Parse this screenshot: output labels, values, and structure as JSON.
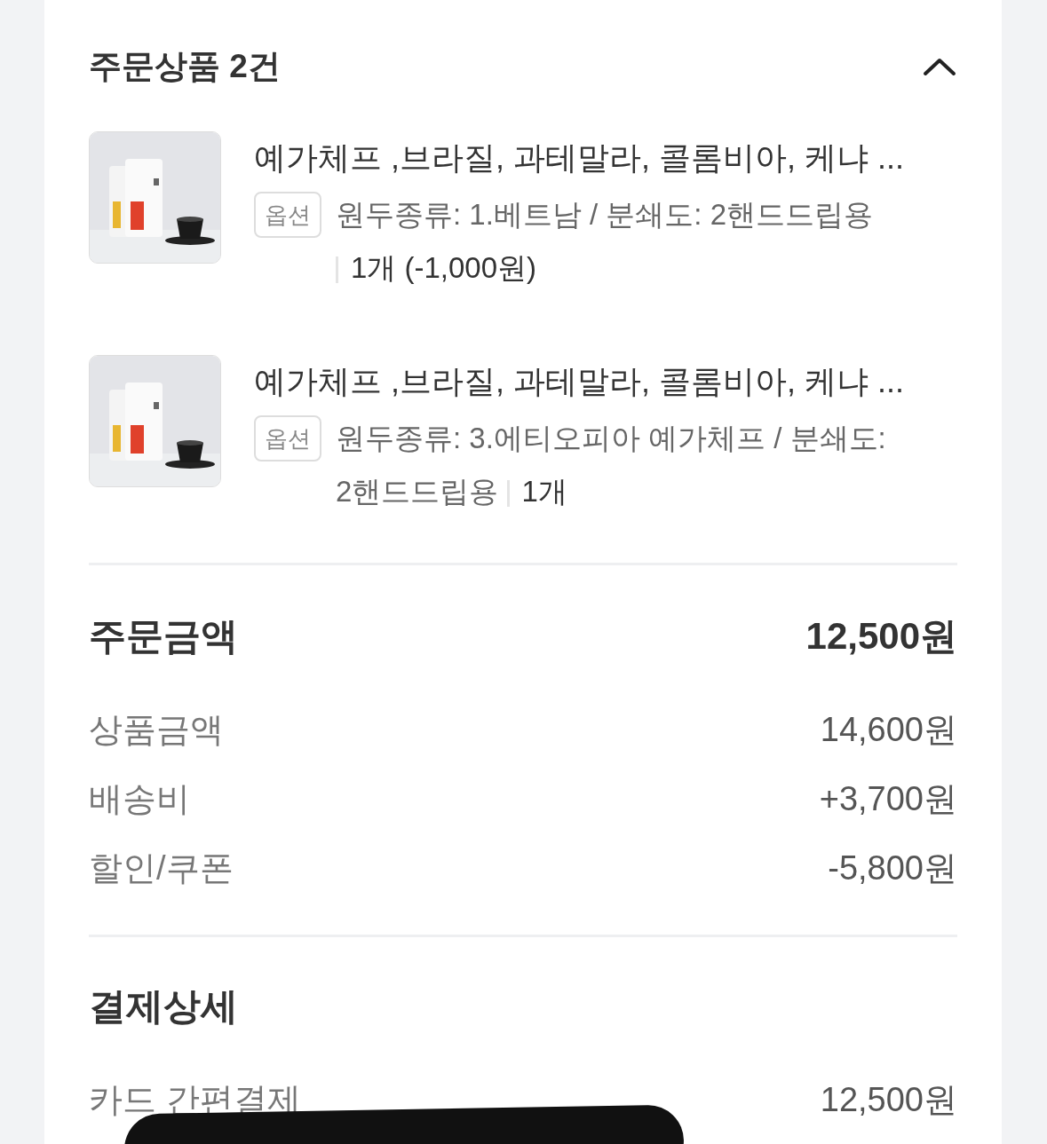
{
  "header": {
    "title": "주문상품 2건",
    "expanded": true
  },
  "items": [
    {
      "kind": "picture",
      "title": "예가체프 ,브라질, 과테말라, 콜롬비아, 케냐 ...",
      "option_badge": "옵션",
      "option": "원두종류: 1.베트남 / 분쇄도: 2핸드드립용",
      "quantity": "1개 (-1,000원)"
    },
    {
      "kind": "picture",
      "title": "예가체프 ,브라질, 과테말라, 콜롬비아, 케냐 ...",
      "option_badge": "옵션",
      "option": "원두종류: 3.에티오피아 예가체프 / 분쇄도: 2핸드드립용",
      "quantity": "1개"
    }
  ],
  "order_total": {
    "label": "주문금액",
    "value": "12,500원"
  },
  "breakdown": [
    {
      "label": "상품금액",
      "value": "14,600원"
    },
    {
      "label": "배송비",
      "value": "+3,700원"
    },
    {
      "label": "할인/쿠폰",
      "value": "-5,800원"
    }
  ],
  "payment": {
    "title": "결제상세",
    "rows": [
      {
        "label": "카드 간편결제",
        "value": "12,500원"
      }
    ]
  }
}
